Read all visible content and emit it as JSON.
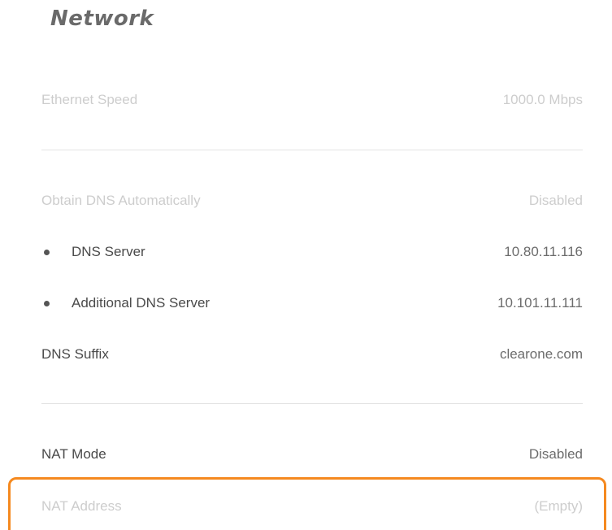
{
  "page": {
    "title": "Network"
  },
  "rows": {
    "ethernet_speed": {
      "label": "Ethernet Speed",
      "value": "1000.0 Mbps"
    },
    "obtain_dns": {
      "label": "Obtain DNS Automatically",
      "value": "Disabled"
    },
    "dns_server": {
      "label": "DNS Server",
      "value": "10.80.11.116"
    },
    "additional_dns_server": {
      "label": "Additional DNS Server",
      "value": "10.101.11.111"
    },
    "dns_suffix": {
      "label": "DNS Suffix",
      "value": "clearone.com"
    },
    "nat_mode": {
      "label": "NAT Mode",
      "value": "Disabled"
    },
    "nat_address": {
      "label": "NAT Address",
      "value": "(Empty)"
    }
  },
  "colors": {
    "highlight": "#f5891f",
    "text_primary": "#4a4a4a",
    "text_disabled": "#cdcdcd",
    "divider": "#e3e3e3"
  }
}
